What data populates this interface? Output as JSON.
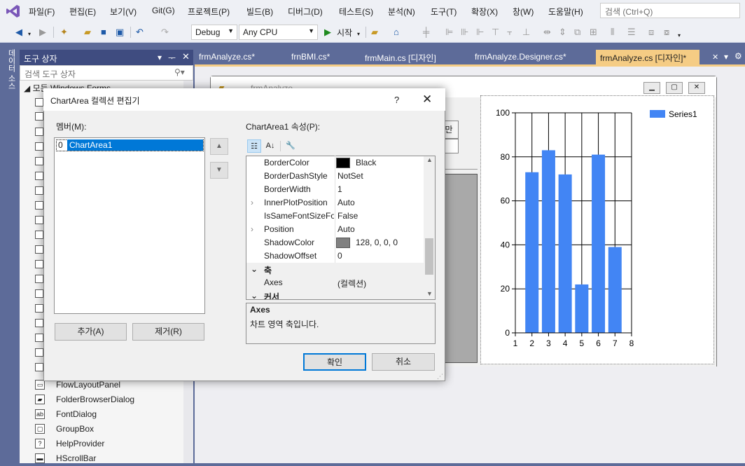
{
  "menu": [
    "파일(F)",
    "편집(E)",
    "보기(V)",
    "Git(G)",
    "프로젝트(P)",
    "빌드(B)",
    "디버그(D)",
    "테스트(S)",
    "분석(N)",
    "도구(T)",
    "확장(X)",
    "창(W)",
    "도움말(H)"
  ],
  "search_placeholder": "검색 (Ctrl+Q)",
  "toolbar": {
    "config": "Debug",
    "platform": "Any CPU",
    "start": "시작"
  },
  "side_tab": "데이터 소스",
  "toolbox": {
    "title": "도구 상자",
    "search_placeholder": "검색 도구 상자",
    "group": "모든 Windows Forms",
    "items": [
      "FlowLayoutPanel",
      "FolderBrowserDialog",
      "FontDialog",
      "GroupBox",
      "HelpProvider",
      "HScrollBar"
    ]
  },
  "doc_tabs": [
    "frmAnalyze.cs*",
    "frnBMI.cs*",
    "frmMain.cs [디자인]",
    "frmAnalyze.Designer.cs*",
    "frmAnalyze.cs [디자인]*"
  ],
  "form": {
    "title": "frmAnalyze",
    "button_label": "만"
  },
  "dialog": {
    "title": "ChartArea 컬렉션 편집기",
    "members_label": "멤버(M):",
    "members": [
      {
        "index": "0",
        "name": "ChartArea1"
      }
    ],
    "props_label": "ChartArea1 속성(P):",
    "add_button": "추가(A)",
    "remove_button": "제거(R)",
    "ok_button": "확인",
    "cancel_button": "취소",
    "properties": [
      {
        "name": "BorderColor",
        "value": "Black",
        "swatch": "#000000"
      },
      {
        "name": "BorderDashStyle",
        "value": "NotSet"
      },
      {
        "name": "BorderWidth",
        "value": "1"
      },
      {
        "name": "InnerPlotPosition",
        "value": "Auto",
        "expandable": true
      },
      {
        "name": "IsSameFontSizeFor",
        "value": "False"
      },
      {
        "name": "Position",
        "value": "Auto",
        "expandable": true
      },
      {
        "name": "ShadowColor",
        "value": "128, 0, 0, 0",
        "swatch": "#808080"
      },
      {
        "name": "ShadowOffset",
        "value": "0"
      }
    ],
    "category_axes": "축",
    "axes_prop": {
      "name": "Axes",
      "value": "(컬렉션)"
    },
    "category_cursor": "커서",
    "desc_title": "Axes",
    "desc_text": "차트 영역 축입니다."
  },
  "chart_data": {
    "type": "bar",
    "x": [
      2,
      3,
      4,
      5,
      6,
      7
    ],
    "values": [
      73,
      83,
      72,
      22,
      81,
      39
    ],
    "xlim": [
      1,
      8
    ],
    "ylim": [
      0,
      100
    ],
    "xticks": [
      "1",
      "2",
      "3",
      "4",
      "5",
      "6",
      "7",
      "8"
    ],
    "yticks": [
      "0",
      "20",
      "40",
      "60",
      "80",
      "100"
    ],
    "series": [
      {
        "name": "Series1",
        "color": "#4285f4"
      }
    ],
    "legend": "top-right",
    "grid": true
  }
}
